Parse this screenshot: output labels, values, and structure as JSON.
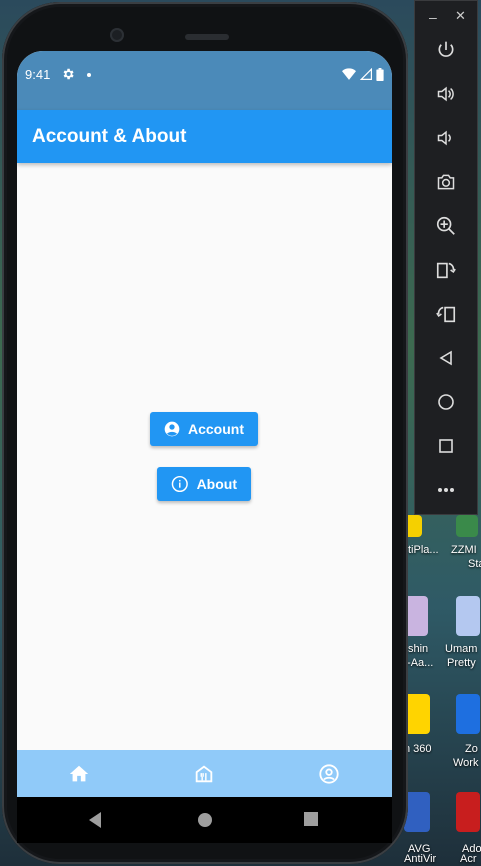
{
  "status": {
    "time": "9:41"
  },
  "appbar": {
    "title": "Account & About"
  },
  "buttons": {
    "account_label": "Account",
    "about_label": "About"
  },
  "bottom_nav": {
    "items": [
      {
        "icon": "home-icon"
      },
      {
        "icon": "house-app-icon"
      },
      {
        "icon": "account-circle-icon"
      }
    ]
  },
  "emulator_toolbar": {
    "items": [
      "power-icon",
      "volume-up-icon",
      "volume-down-icon",
      "camera-icon",
      "zoom-in-icon",
      "rotate-left-icon",
      "rotate-right-icon",
      "back-icon",
      "home-circle-icon",
      "overview-icon",
      "more-icon"
    ]
  },
  "desktop": {
    "labels": [
      "tiPla...",
      "ZZMI",
      "Sta",
      "shin",
      "t-Aa...",
      "Umam",
      "Pretty",
      "n 360",
      "Zo",
      "Work",
      "AVG",
      "AntiVir",
      "Ado",
      "Acr"
    ]
  },
  "colors": {
    "status_bar": "#4b8ab9",
    "app_bar": "#2196f3",
    "button": "#2196f3",
    "bottom_nav": "#90caf9",
    "background": "#fafafa"
  }
}
